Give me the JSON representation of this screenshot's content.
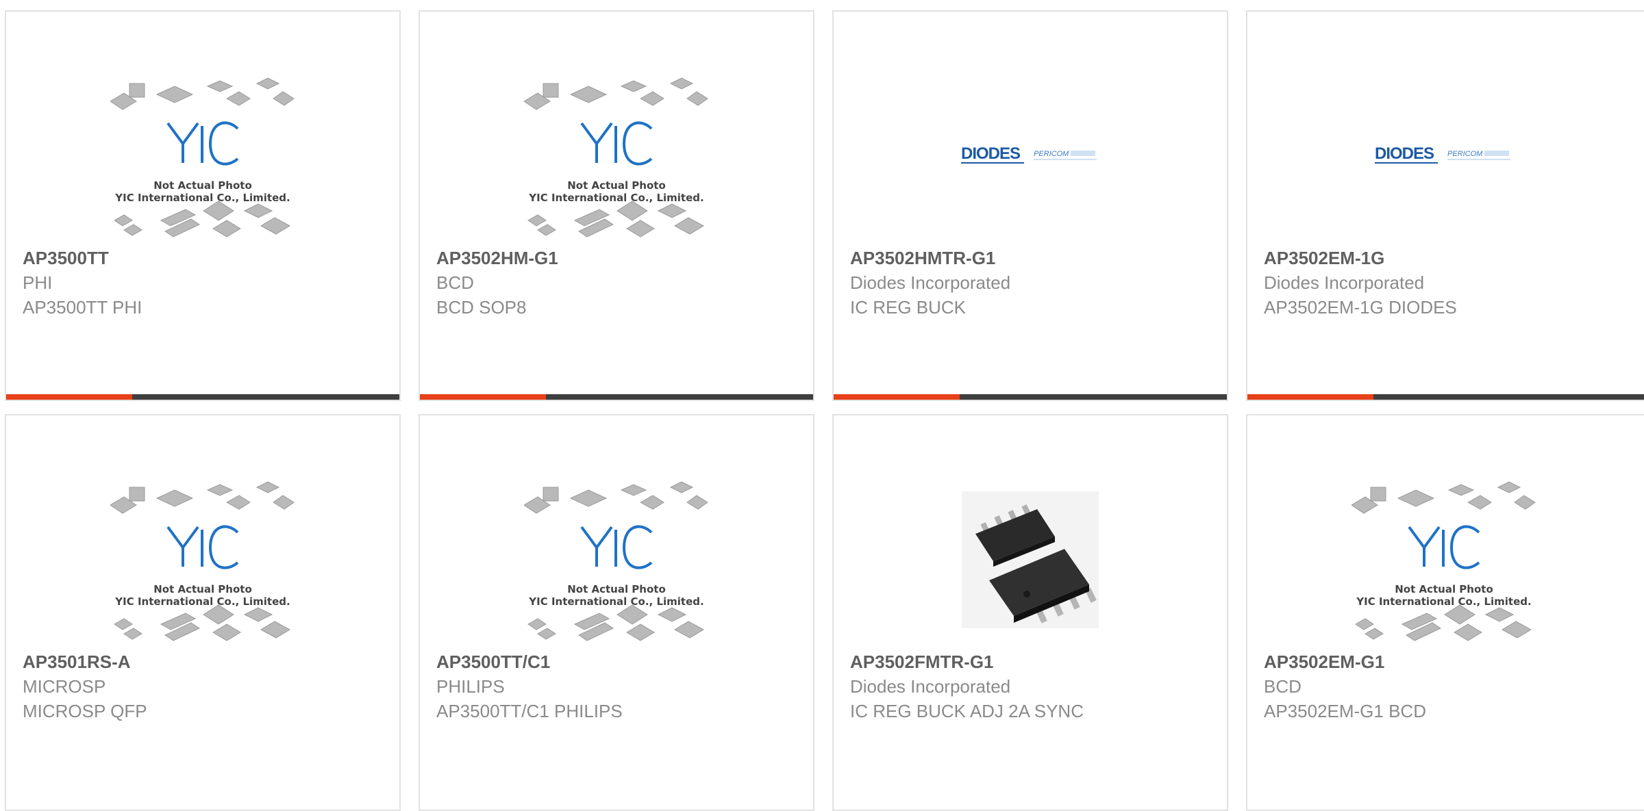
{
  "colors": {
    "accent": "#e7411a",
    "bar_dark": "#3f3f3f",
    "yic_blue": "#1f72c6",
    "diodes_blue": "#1b5aa5"
  },
  "placeholder": {
    "line1": "Not Actual Photo",
    "line2": "YIC International Co., Limited.",
    "logo": "YIC"
  },
  "diodes_logo": {
    "brand": "DIODES",
    "partner": "PERICOM"
  },
  "products": [
    {
      "part_number": "AP3500TT",
      "manufacturer": "PHI",
      "description": "AP3500TT PHI",
      "image": "yic-placeholder"
    },
    {
      "part_number": "AP3502HM-G1",
      "manufacturer": "BCD",
      "description": "BCD SOP8",
      "image": "yic-placeholder"
    },
    {
      "part_number": "AP3502HMTR-G1",
      "manufacturer": "Diodes Incorporated",
      "description": "IC REG BUCK",
      "image": "diodes-logo"
    },
    {
      "part_number": "AP3502EM-1G",
      "manufacturer": "Diodes Incorporated",
      "description": "AP3502EM-1G DIODES",
      "image": "diodes-logo"
    },
    {
      "part_number": "AP3501RS-A",
      "manufacturer": "MICROSP",
      "description": "MICROSP QFP",
      "image": "yic-placeholder"
    },
    {
      "part_number": "AP3500TT/C1",
      "manufacturer": "PHILIPS",
      "description": "AP3500TT/C1 PHILIPS",
      "image": "yic-placeholder"
    },
    {
      "part_number": "AP3502FMTR-G1",
      "manufacturer": "Diodes Incorporated",
      "description": "IC REG BUCK ADJ 2A SYNC",
      "image": "soic8-photo"
    },
    {
      "part_number": "AP3502EM-G1",
      "manufacturer": "BCD",
      "description": "AP3502EM-G1 BCD",
      "image": "yic-placeholder"
    }
  ]
}
